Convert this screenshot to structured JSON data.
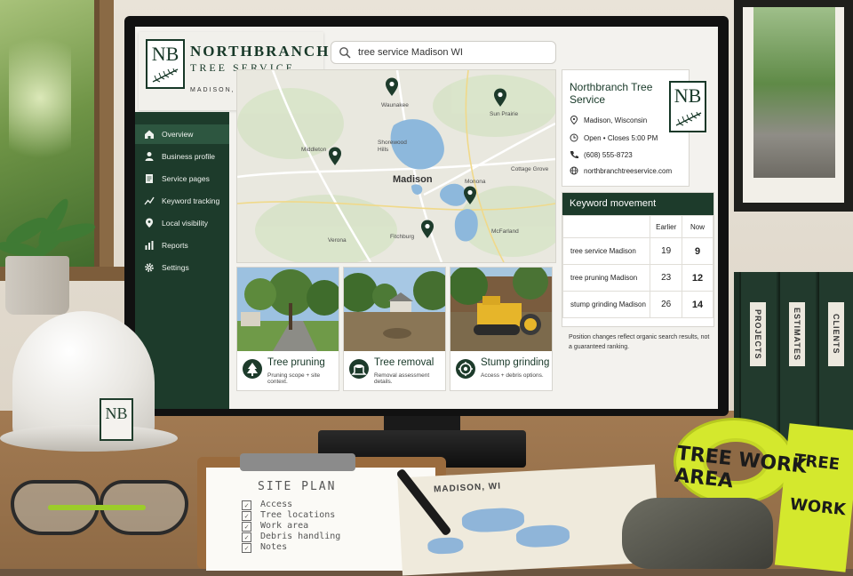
{
  "brand": {
    "logo": "NB",
    "name": "NORTHBRANCH",
    "subtitle": "TREE SERVICE",
    "location": "MADISON, WISCONSIN"
  },
  "search": {
    "value": "tree service Madison WI"
  },
  "sidebar": {
    "items": [
      {
        "label": "Overview",
        "icon": "home-icon",
        "active": true
      },
      {
        "label": "Business profile",
        "icon": "person-icon"
      },
      {
        "label": "Service pages",
        "icon": "document-icon"
      },
      {
        "label": "Keyword tracking",
        "icon": "trend-icon"
      },
      {
        "label": "Local visibility",
        "icon": "location-pin-icon"
      },
      {
        "label": "Reports",
        "icon": "bar-chart-icon"
      },
      {
        "label": "Settings",
        "icon": "gear-icon"
      }
    ]
  },
  "map": {
    "city": "Madison",
    "places": [
      "Waunakee",
      "Sun Prairie",
      "Middleton",
      "Shorewood Hills",
      "Monona",
      "Cottage Grove",
      "Verona",
      "Fitchburg",
      "McFarland"
    ]
  },
  "services": [
    {
      "title": "Tree pruning",
      "subtitle": "Pruning scope + site context.",
      "icon": "pine-tree-icon"
    },
    {
      "title": "Tree removal",
      "subtitle": "Removal assessment details.",
      "icon": "stump-icon"
    },
    {
      "title": "Stump grinding",
      "subtitle": "Access + debris options.",
      "icon": "grinder-icon"
    }
  ],
  "business": {
    "name": "Northbranch Tree Service",
    "logo": "NB",
    "address": "Madison, Wisconsin",
    "hours": "Open • Closes 5:00 PM",
    "phone": "(608) 555-8723",
    "website": "northbranchtreeservice.com"
  },
  "keywords": {
    "title": "Keyword movement",
    "col_earlier": "Earlier",
    "col_now": "Now",
    "rows": [
      {
        "keyword": "tree service Madison",
        "earlier": "19",
        "now": "9"
      },
      {
        "keyword": "tree pruning Madison",
        "earlier": "23",
        "now": "12"
      },
      {
        "keyword": "stump grinding Madison",
        "earlier": "26",
        "now": "14"
      }
    ],
    "note": "Position changes reflect organic search results, not a guaranteed ranking."
  },
  "desk": {
    "hat_logo": "NB",
    "binders": [
      "PROJECTS",
      "ESTIMATES",
      "CLIENTS"
    ],
    "clipboard_title": "SITE PLAN",
    "clipboard_items": [
      "Access",
      "Tree locations",
      "Work area",
      "Debris handling",
      "Notes"
    ],
    "map_title": "MADISON, WI",
    "tape_text": "TREE WORK AREA"
  },
  "colors": {
    "brand_green": "#1d3b2b",
    "accent_green": "#2d5640",
    "tape_yellow": "#d4e82d"
  }
}
